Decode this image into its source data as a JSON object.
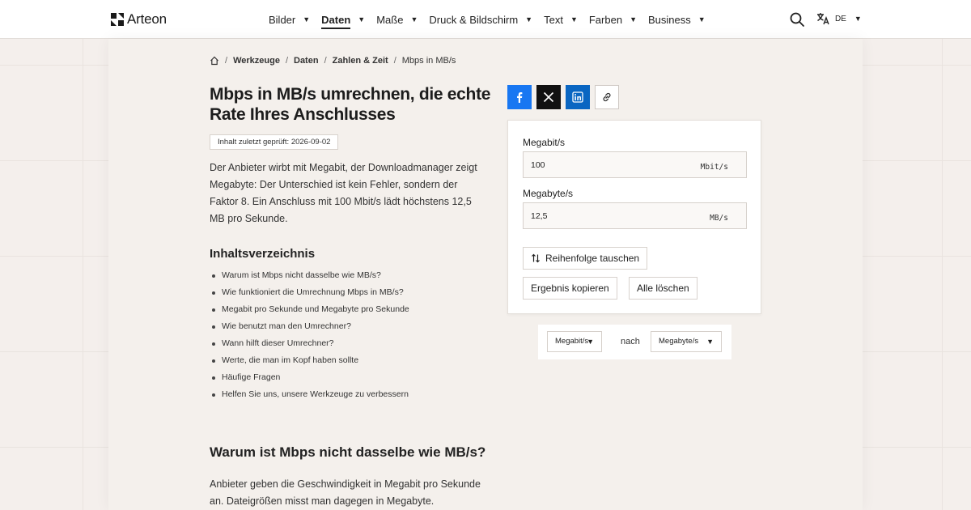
{
  "header": {
    "logo_text": "Arteon",
    "nav": [
      {
        "label": "Bilder",
        "active": false
      },
      {
        "label": "Daten",
        "active": true
      },
      {
        "label": "Maße",
        "active": false
      },
      {
        "label": "Druck & Bildschirm",
        "active": false
      },
      {
        "label": "Text",
        "active": false
      },
      {
        "label": "Farben",
        "active": false
      },
      {
        "label": "Business",
        "active": false
      }
    ],
    "lang": "DE"
  },
  "breadcrumb": {
    "items": [
      "Werkzeuge",
      "Daten",
      "Zahlen & Zeit"
    ],
    "current": "Mbps in MB/s"
  },
  "article": {
    "title": "Mbps in MB/s umrechnen, die echte Rate Ihres Anschlusses",
    "checked": "Inhalt zuletzt geprüft: 2026-09-02",
    "intro": "Der Anbieter wirbt mit Megabit, der Downloadmanager zeigt Megabyte: Der Unterschied ist kein Fehler, sondern der Faktor 8. Ein Anschluss mit 100 Mbit/s lädt höchstens 12,5 MB pro Sekunde.",
    "toc_title": "Inhaltsverzeichnis",
    "toc": [
      "Warum ist Mbps nicht dasselbe wie MB/s?",
      "Wie funktioniert die Umrechnung Mbps in MB/s?",
      "Megabit pro Sekunde und Megabyte pro Sekunde",
      "Wie benutzt man den Umrechner?",
      "Wann hilft dieser Umrechner?",
      "Werte, die man im Kopf haben sollte",
      "Häufige Fragen",
      "Helfen Sie uns, unsere Werkzeuge zu verbessern"
    ],
    "section_heading": "Warum ist Mbps nicht dasselbe wie MB/s?",
    "section_text": "Anbieter geben die Geschwindigkeit in Megabit pro Sekunde an. Dateigrößen misst man dagegen in Megabyte."
  },
  "converter": {
    "from_label": "Megabit/s",
    "from_value": "100",
    "from_unit": "Mbit/s",
    "to_label": "Megabyte/s",
    "to_value": "12,5",
    "to_unit": "MB/s",
    "swap_label": "Reihenfolge tauschen",
    "copy_label": "Ergebnis kopieren",
    "clear_label": "Alle löschen"
  },
  "unit_selector": {
    "from": "Megabit/s",
    "between": "nach",
    "to": "Megabyte/s"
  },
  "colors": {
    "facebook": "#1877f2",
    "x": "#111111",
    "linkedin": "#0a66c2"
  }
}
